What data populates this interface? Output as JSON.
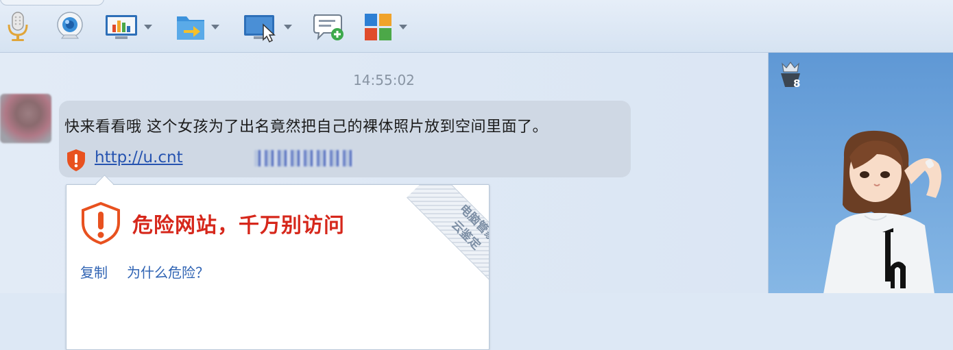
{
  "toolbar": {
    "items": [
      {
        "icon": "microphone-icon"
      },
      {
        "icon": "webcam-icon"
      },
      {
        "icon": "screen-chart-icon",
        "has_dropdown": true
      },
      {
        "icon": "file-transfer-icon",
        "has_dropdown": true
      },
      {
        "icon": "remote-desktop-icon",
        "has_dropdown": true
      },
      {
        "icon": "message-add-icon"
      },
      {
        "icon": "apps-grid-icon",
        "has_dropdown": true
      }
    ]
  },
  "chat": {
    "timestamp": "14:55:02",
    "message": {
      "text": "快来看看哦  这个女孩为了出名竟然把自己的裸体照片放到空间里面了。",
      "link": "http://u.cnt"
    },
    "warning_popup": {
      "title": "危险网站，千万别访问",
      "copy_label": "复制",
      "why_label": "为什么危险？",
      "ribbon_line1": "电脑管家",
      "ribbon_line2": "云鉴定",
      "danger_color": "#d6271b"
    }
  },
  "side_panel": {
    "level": "8"
  }
}
